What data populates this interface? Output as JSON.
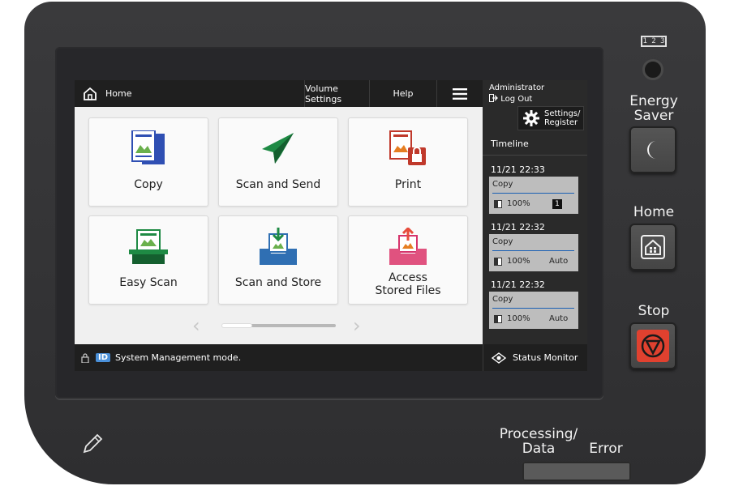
{
  "topbar": {
    "home_label": "Home",
    "volume_label": "Volume Settings",
    "help_label": "Help"
  },
  "tiles": [
    {
      "label": "Copy",
      "icon": "copy-icon"
    },
    {
      "label": "Scan and Send",
      "icon": "paper-plane-icon"
    },
    {
      "label": "Print",
      "icon": "print-lock-icon"
    },
    {
      "label": "Easy Scan",
      "icon": "scanner-icon"
    },
    {
      "label": "Scan and Store",
      "icon": "tray-store-icon"
    },
    {
      "label": "Access\nStored Files",
      "icon": "stored-files-icon"
    }
  ],
  "side_panel": {
    "admin_label": "Administrator",
    "logout_label": "Log Out",
    "settings_label_line1": "Settings/",
    "settings_label_line2": "Register",
    "timeline_title": "Timeline",
    "jobs": [
      {
        "time": "11/21 22:33",
        "name": "Copy",
        "percent": "100%",
        "mode": "1"
      },
      {
        "time": "11/21 22:32",
        "name": "Copy",
        "percent": "100%",
        "mode": "Auto"
      },
      {
        "time": "11/21 22:32",
        "name": "Copy",
        "percent": "100%",
        "mode": "Auto"
      }
    ]
  },
  "statusbar": {
    "id_badge": "ID",
    "message": "System Management mode.",
    "status_monitor_label": "Status Monitor"
  },
  "hardware": {
    "keypad_label": "1 2 3",
    "energy_saver_line1": "Energy",
    "energy_saver_line2": "Saver",
    "home_label": "Home",
    "stop_label": "Stop",
    "processing_line1": "Processing/",
    "processing_line2": "Data",
    "error_label": "Error"
  },
  "colors": {
    "accent_blue": "#4a90d9",
    "stop_red": "#e0412f",
    "bar_dark": "#1f1f1f"
  }
}
